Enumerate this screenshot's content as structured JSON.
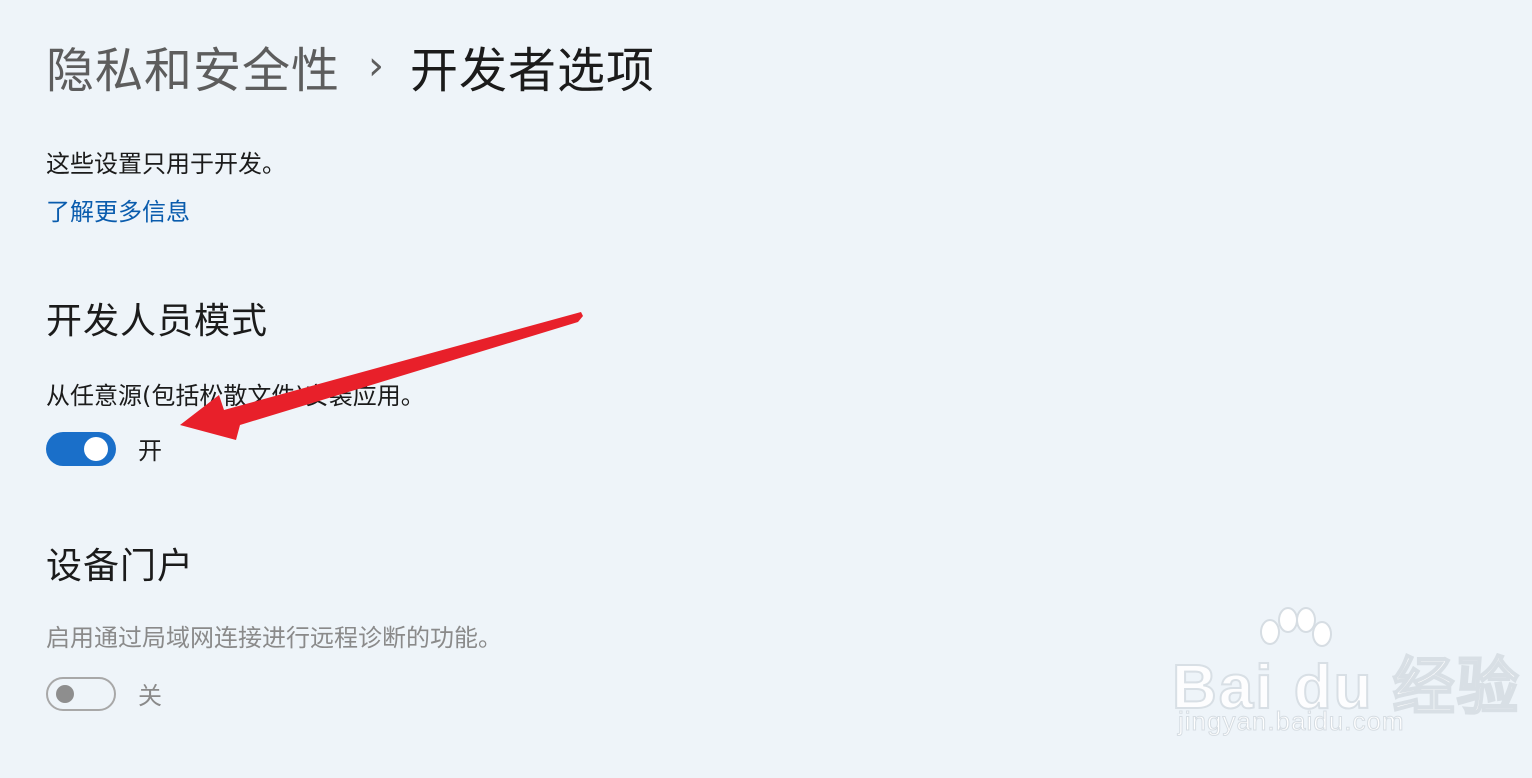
{
  "breadcrumb": {
    "parent": "隐私和安全性",
    "separator": "›",
    "current": "开发者选项"
  },
  "intro": {
    "description": "这些设置只用于开发。",
    "learn_more": "了解更多信息"
  },
  "developer_mode": {
    "title": "开发人员模式",
    "description": "从任意源(包括松散文件)安装应用。",
    "toggle_label": "开",
    "state": "on"
  },
  "device_portal": {
    "title": "设备门户",
    "description": "启用通过局域网连接进行远程诊断的功能。",
    "toggle_label": "关",
    "state": "off"
  },
  "annotation": {
    "arrow_color": "#e8202a"
  },
  "watermark": {
    "logo": "Bai du 经验",
    "url": "jingyan.baidu.com"
  },
  "colors": {
    "background": "#eef4f9",
    "accent": "#1a6fc9",
    "link": "#0a5cad",
    "disabled_text": "#8a8a8a"
  }
}
